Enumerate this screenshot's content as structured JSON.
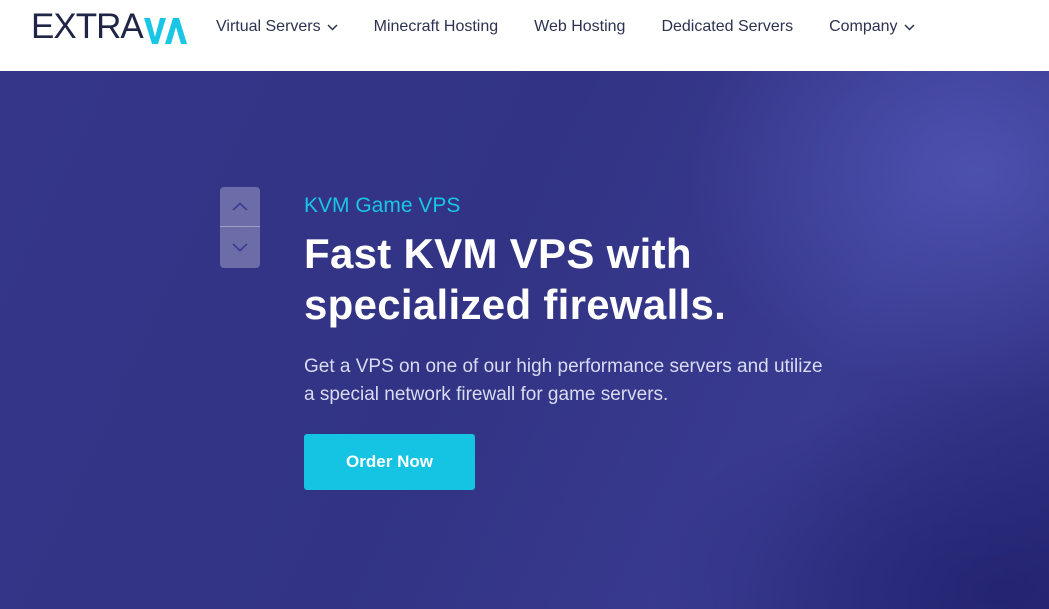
{
  "brand": {
    "logo_text": "EXTRA",
    "logo_mark_text": "VM",
    "colors": {
      "dark": "#1f2547",
      "accent": "#19c6e6"
    }
  },
  "nav": {
    "items": [
      {
        "label": "Virtual Servers",
        "has_dropdown": true,
        "icon": "chevron-down-icon"
      },
      {
        "label": "Minecraft Hosting",
        "has_dropdown": false
      },
      {
        "label": "Web Hosting",
        "has_dropdown": false
      },
      {
        "label": "Dedicated Servers",
        "has_dropdown": false
      },
      {
        "label": "Company",
        "has_dropdown": true,
        "icon": "chevron-down-icon"
      }
    ]
  },
  "hero": {
    "eyebrow": "KVM Game VPS",
    "headline_line1": "Fast KVM VPS with",
    "headline_line2": "specialized firewalls.",
    "description_line1": "Get a VPS on one of our high performance servers and utilize",
    "description_line2": "a special network firewall for game servers.",
    "cta_label": "Order Now",
    "slider_controls": {
      "up_icon": "chevron-up-icon",
      "down_icon": "chevron-down-icon"
    },
    "colors": {
      "background": "#34358a",
      "cta": "#15c3e3",
      "eyebrow": "#19c6e6"
    }
  }
}
